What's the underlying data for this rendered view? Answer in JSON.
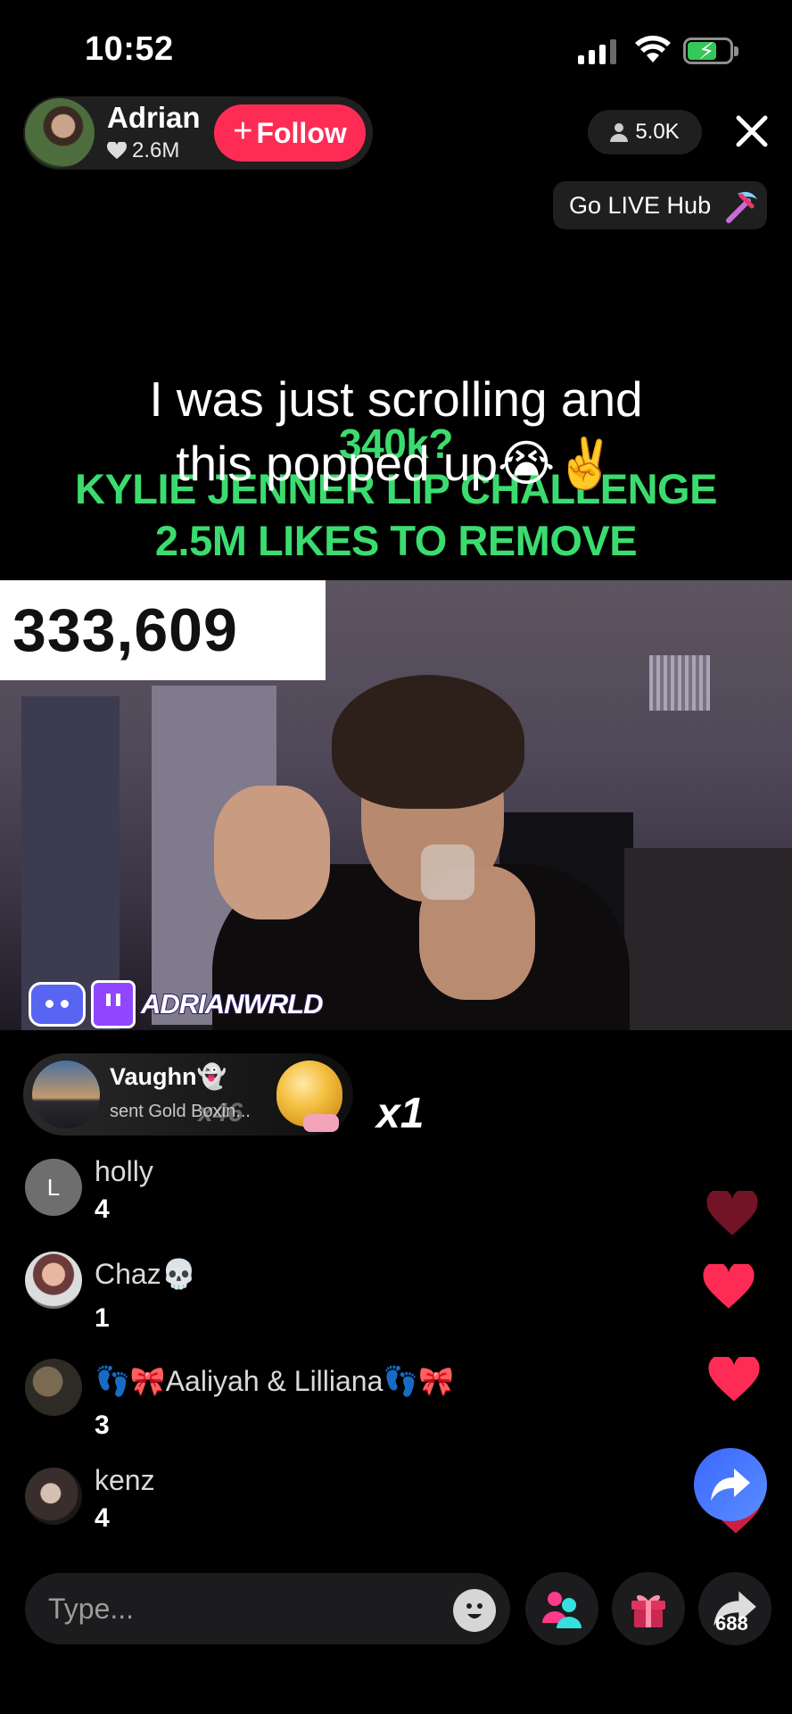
{
  "status_bar": {
    "time": "10:52"
  },
  "host": {
    "name": "Adrian",
    "likes": "2.6M",
    "follow_label": "Follow"
  },
  "viewers": {
    "count": "5.0K"
  },
  "go_live_hub": {
    "label": "Go LIVE Hub"
  },
  "overlay": {
    "green_line_1": "340k?",
    "green_line_2": "KYLIE JENNER LIP CHALLENGE",
    "green_line_3": "2.5M LIKES TO REMOVE",
    "caption_line_1": "I was just scrolling and",
    "caption_line_2": "this popped up😭✌️"
  },
  "video": {
    "counter": "333,609",
    "channel_tag": "ADRIANWRLD"
  },
  "gift": {
    "sender": "Vaughn👻",
    "text": "sent Gold Boxin...",
    "ghost_combo": "x46",
    "count": "x1"
  },
  "comments": [
    {
      "name": "holly",
      "value": "4",
      "avatar_letter": "L"
    },
    {
      "name": "Chaz💀",
      "value": "1"
    },
    {
      "name": "👣🎀Aaliyah & Lilliana👣🎀",
      "value": "3"
    },
    {
      "name": "kenz",
      "value": "4"
    }
  ],
  "bottom_bar": {
    "placeholder": "Type...",
    "share_count": "688"
  },
  "colors": {
    "follow": "#fe2c55",
    "green_text": "#3bdc6f",
    "heart": "#fe2c55",
    "share_fab": "#3a67ff"
  },
  "icons": [
    "signal-icon",
    "wifi-icon",
    "battery-icon",
    "heart-icon",
    "person-icon",
    "close-icon",
    "pickaxe-icon",
    "discord-icon",
    "twitch-icon",
    "boxing-glove-icon",
    "emoji-icon",
    "guests-icon",
    "gift-icon",
    "share-icon"
  ]
}
